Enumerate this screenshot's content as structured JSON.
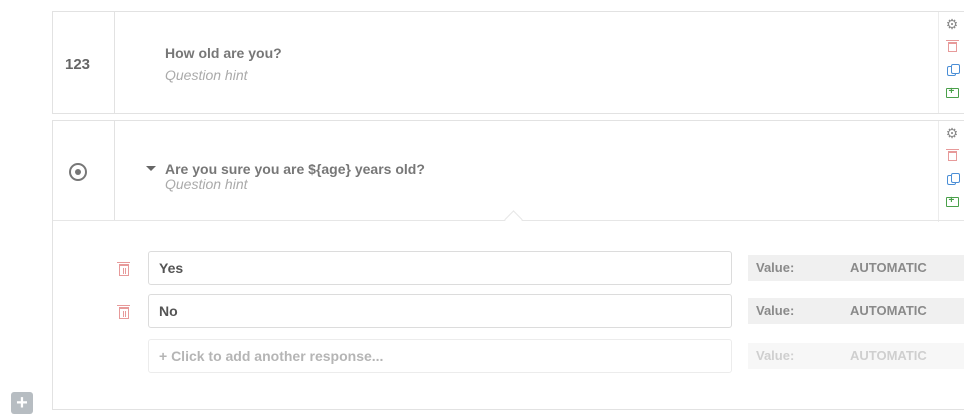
{
  "questions": [
    {
      "number": "123",
      "title": "How old are you?",
      "hint": "Question hint"
    },
    {
      "title": "Are you sure you are ${age} years old?",
      "hint": "Question hint",
      "responses": [
        {
          "label": "Yes",
          "value_label": "Value:",
          "value": "AUTOMATIC"
        },
        {
          "label": "No",
          "value_label": "Value:",
          "value": "AUTOMATIC"
        }
      ],
      "add_response": {
        "placeholder": "+ Click to add another response...",
        "value_label": "Value:",
        "value": "AUTOMATIC"
      }
    }
  ],
  "tools": {
    "settings_icon": "gear-icon",
    "delete_icon": "trash-icon",
    "copy_icon": "copy-icon",
    "move_icon": "folder-add-icon",
    "settings_glyph": "⚙"
  },
  "add_button": {
    "label": "+"
  }
}
